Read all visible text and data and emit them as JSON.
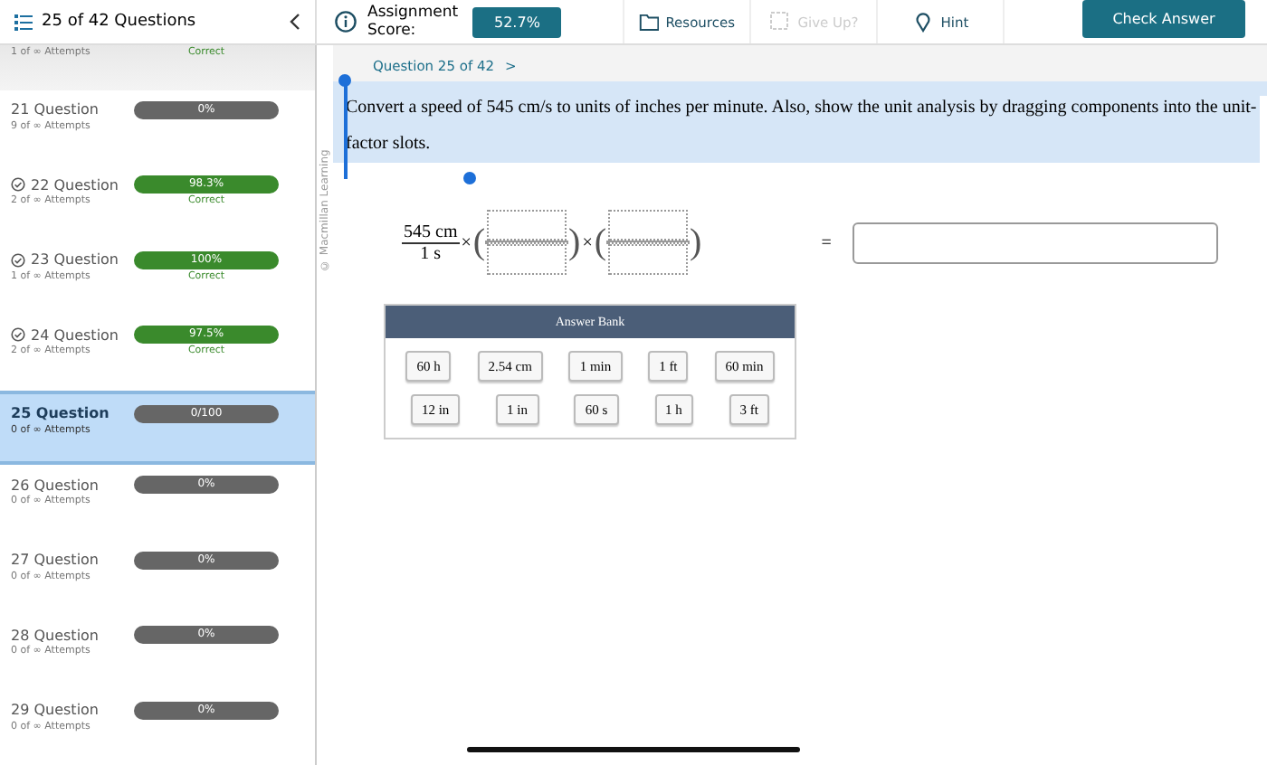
{
  "header": {
    "questions_label": "25 of 42 Questions",
    "score_label": "Assignment Score:",
    "score": "52.7%",
    "tools": [
      {
        "kind": "resources",
        "label": "Resources",
        "disabled": false
      },
      {
        "kind": "giveup",
        "label": "Give Up?",
        "disabled": true
      },
      {
        "kind": "hint",
        "label": "Hint",
        "disabled": false
      }
    ],
    "check_button": "Check Answer"
  },
  "sidebar": {
    "items": [
      {
        "attempts": "1 of ∞ Attempts",
        "status": "Correct",
        "correct": true,
        "selected": false
      },
      {
        "title": "21 Question",
        "attempts": "9 of ∞ Attempts",
        "score": "0%",
        "correct": false,
        "selected": false
      },
      {
        "title": "22 Question",
        "attempts": "2 of ∞ Attempts",
        "score": "98.3%",
        "status": "Correct",
        "correct": true,
        "selected": false
      },
      {
        "title": "23 Question",
        "attempts": "1 of ∞ Attempts",
        "score": "100%",
        "status": "Correct",
        "correct": true,
        "selected": false
      },
      {
        "title": "24 Question",
        "attempts": "2 of ∞ Attempts",
        "score": "97.5%",
        "status": "Correct",
        "correct": true,
        "selected": false
      },
      {
        "title": "25 Question",
        "attempts": "0 of ∞ Attempts",
        "score": "0/100",
        "correct": false,
        "selected": true
      },
      {
        "title": "26 Question",
        "attempts": "0 of ∞ Attempts",
        "score": "0%",
        "correct": false,
        "selected": false
      },
      {
        "title": "27 Question",
        "attempts": "0 of ∞ Attempts",
        "score": "0%",
        "correct": false,
        "selected": false
      },
      {
        "title": "28 Question",
        "attempts": "0 of ∞ Attempts",
        "score": "0%",
        "correct": false,
        "selected": false
      },
      {
        "title": "29 Question",
        "attempts": "0 of ∞ Attempts",
        "score": "0%",
        "correct": false,
        "selected": false
      }
    ]
  },
  "question": {
    "nav": "Question 25 of 42",
    "next": ">",
    "copyright": "© Macmillan Learning",
    "text": "Convert a speed of 545 cm/s to units of inches per minute. Also, show the unit analysis by dragging components into the unit-factor slots.",
    "text_selected": true,
    "equation": {
      "numerator": "545 cm",
      "denominator": "1 s",
      "factors": [
        {
          "times": "×",
          "open": "(",
          "close": ")"
        },
        {
          "times": "×",
          "open": "(",
          "close": ")"
        }
      ],
      "equals": "="
    },
    "answer_bank": {
      "title": "Answer Bank",
      "rows": [
        [
          "60 h",
          "2.54 cm",
          "1 min",
          "1 ft",
          "60 min"
        ],
        [
          "12 in",
          "1 in",
          "60 s",
          "1 h",
          "3 ft"
        ]
      ]
    }
  }
}
